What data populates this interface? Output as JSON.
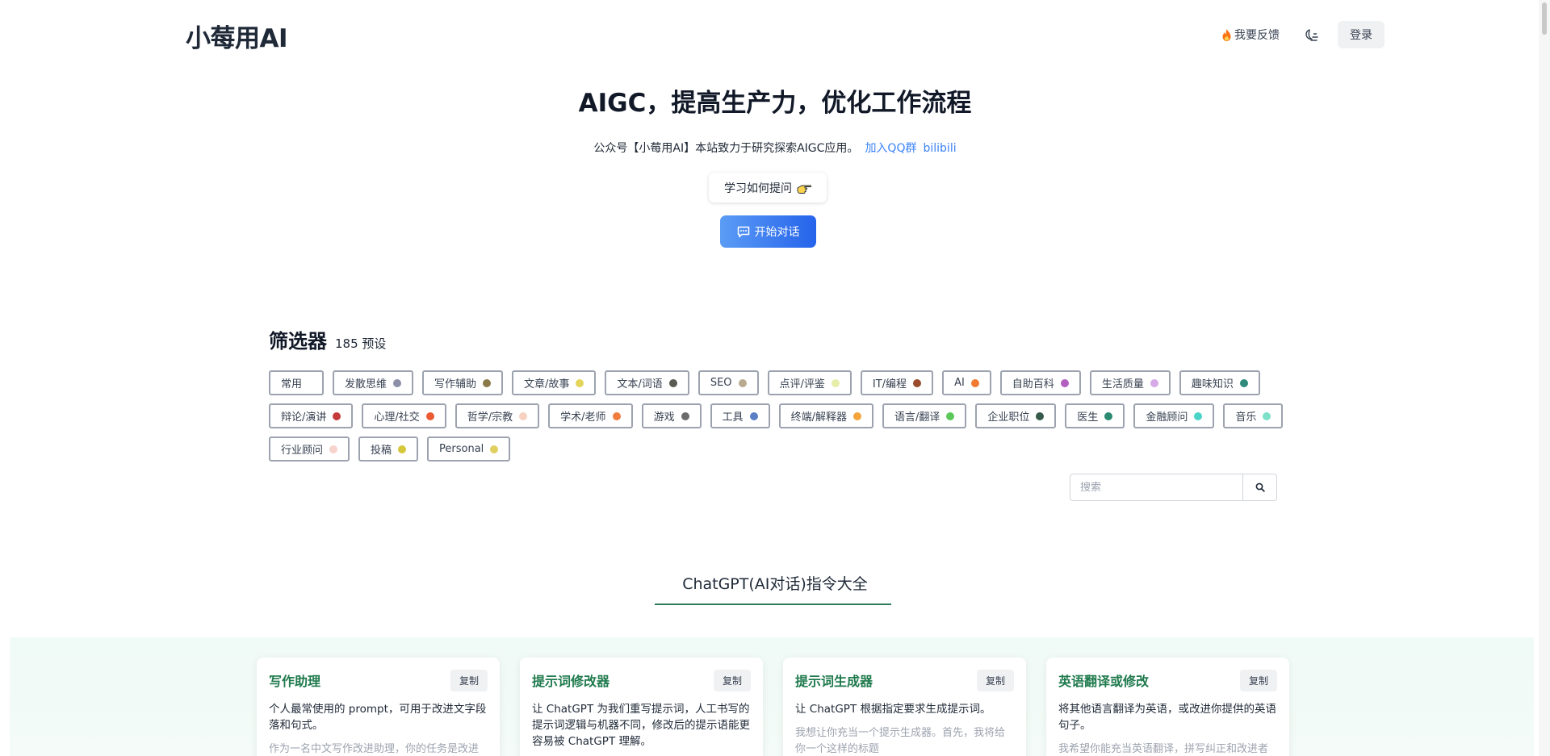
{
  "header": {
    "logo": "小莓用AI",
    "feedback_label": "我要反馈",
    "login_label": "登录"
  },
  "hero": {
    "title": "AIGC，提高生产力，优化工作流程",
    "subtitle": "公众号【小莓用AI】本站致力于研究探索AIGC应用。",
    "link_qq": "加入QQ群",
    "link_bilibili": "bilibili",
    "learn_label": "学习如何提问",
    "start_label": "开始对话"
  },
  "filter": {
    "title": "筛选器",
    "count": "185 预设",
    "tags": [
      {
        "label": "常用",
        "color": ""
      },
      {
        "label": "发散思维",
        "color": "#8b8fa8"
      },
      {
        "label": "写作辅助",
        "color": "#8a7a4a"
      },
      {
        "label": "文章/故事",
        "color": "#e3d55a"
      },
      {
        "label": "文本/词语",
        "color": "#5a5a52"
      },
      {
        "label": "SEO",
        "color": "#b9ab90"
      },
      {
        "label": "点评/评鉴",
        "color": "#e6eeaa"
      },
      {
        "label": "IT/编程",
        "color": "#9a4b2b"
      },
      {
        "label": "AI",
        "color": "#f07a32"
      },
      {
        "label": "自助百科",
        "color": "#b35fc0"
      },
      {
        "label": "生活质量",
        "color": "#d7a9e6"
      },
      {
        "label": "趣味知识",
        "color": "#2f8a7c"
      },
      {
        "label": "辩论/演讲",
        "color": "#c43a3a"
      },
      {
        "label": "心理/社交",
        "color": "#eb5a33"
      },
      {
        "label": "哲学/宗教",
        "color": "#f8d2c0"
      },
      {
        "label": "学术/老师",
        "color": "#f07d3c"
      },
      {
        "label": "游戏",
        "color": "#6b6b6b"
      },
      {
        "label": "工具",
        "color": "#5b7fc4"
      },
      {
        "label": "终端/解释器",
        "color": "#f3a43a"
      },
      {
        "label": "语言/翻译",
        "color": "#5cc85a"
      },
      {
        "label": "企业职位",
        "color": "#355a4a"
      },
      {
        "label": "医生",
        "color": "#2a8a72"
      },
      {
        "label": "金融顾问",
        "color": "#4ad4c8"
      },
      {
        "label": "音乐",
        "color": "#7ee0c8"
      },
      {
        "label": "行业顾问",
        "color": "#f8d2cc"
      },
      {
        "label": "投稿",
        "color": "#d4c83a"
      },
      {
        "label": "Personal",
        "color": "#e0d060"
      }
    ],
    "search_placeholder": "搜索"
  },
  "section": {
    "title": "ChatGPT(AI对话)指令大全"
  },
  "cards": [
    {
      "title": "写作助理",
      "copy_label": "复制",
      "desc": "个人最常使用的 prompt，可用于改进文字段落和句式。",
      "extra": "作为一名中文写作改进助理，你的任务是改进"
    },
    {
      "title": "提示词修改器",
      "copy_label": "复制",
      "desc": "让 ChatGPT 为我们重写提示词，人工书写的提示词逻辑与机器不同，修改后的提示语能更容易被 ChatGPT 理解。",
      "extra": ""
    },
    {
      "title": "提示词生成器",
      "copy_label": "复制",
      "desc": "让 ChatGPT 根据指定要求生成提示词。",
      "extra": "我想让你充当一个提示生成器。首先，我将给你一个这样的标题"
    },
    {
      "title": "英语翻译或修改",
      "copy_label": "复制",
      "desc": "将其他语言翻译为英语，或改进你提供的英语句子。",
      "extra": "我希望你能充当英语翻译，拼写纠正和改进者"
    }
  ]
}
